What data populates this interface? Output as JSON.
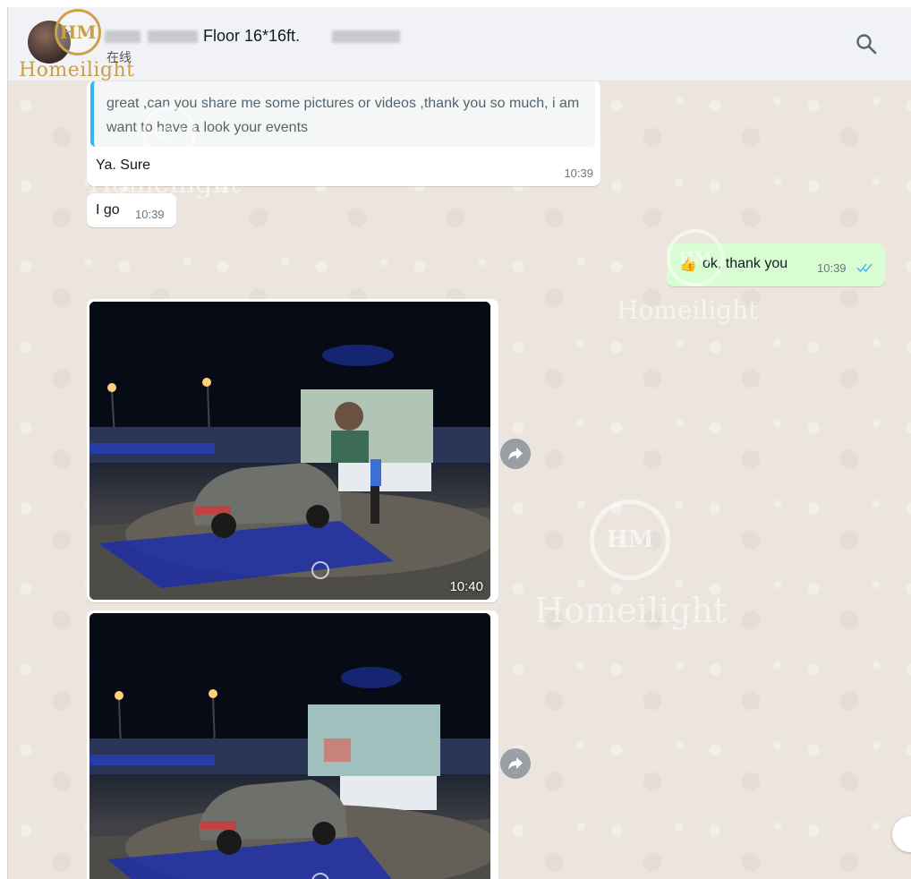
{
  "header": {
    "contact_name": "Floor 16*16ft.",
    "status": "在线",
    "logo_text": "Homeilight",
    "logo_monogram": "HM",
    "search_icon": "search-icon"
  },
  "messages": {
    "quoted_text": "great ,can you share me some pictures or videos ,thank you so much, i am want to have a look your events",
    "reply_text": "Ya. Sure",
    "reply_time": "10:39",
    "msg2_text": "I go",
    "msg2_time": "10:39",
    "out_emoji": "👍",
    "out_text": "ok, thank you",
    "out_time": "10:39",
    "photo1_time": "10:40",
    "photo2_time": ""
  },
  "watermarks": {
    "text": "Homeilight"
  },
  "colors": {
    "outgoing_bubble": "#d9fdd3",
    "quote_bar": "#34b7f1",
    "read_ticks": "#53bdeb",
    "brand_gold": "#c9a04a"
  }
}
